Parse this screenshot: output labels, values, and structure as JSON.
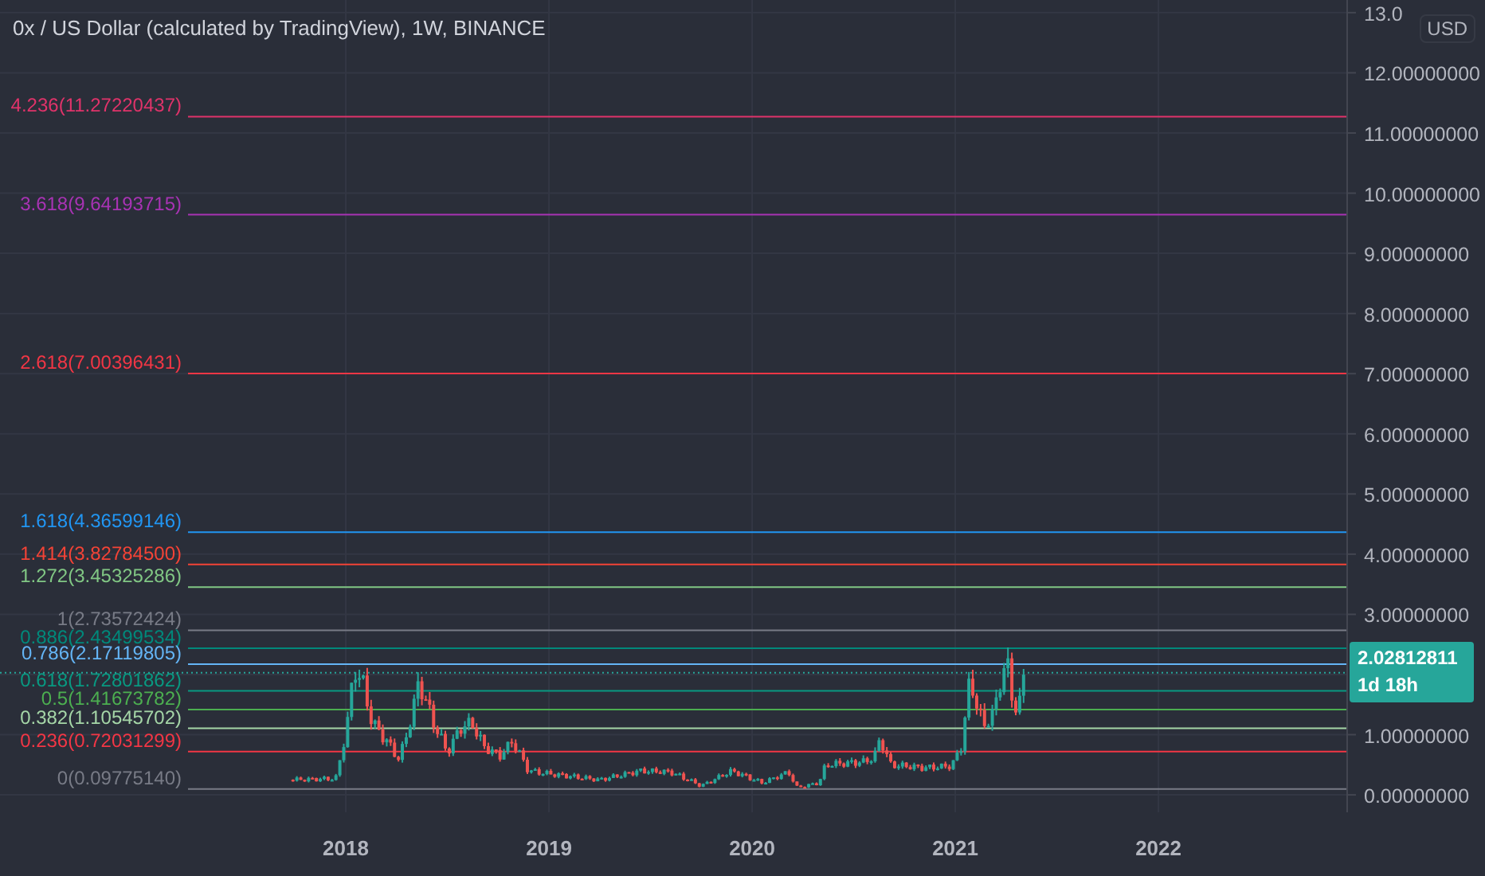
{
  "title": "0x / US Dollar (calculated by TradingView), 1W, BINANCE",
  "currency": "USD",
  "countdown": "1d 18h",
  "chart_data": {
    "type": "line",
    "grid": true,
    "xlim": [
      2016.298,
      2022.925
    ],
    "ylim": [
      -0.29,
      13.21
    ],
    "xticks": [
      {
        "value": 2018,
        "label": "2018"
      },
      {
        "value": 2019,
        "label": "2019"
      },
      {
        "value": 2020,
        "label": "2020"
      },
      {
        "value": 2021,
        "label": "2021"
      },
      {
        "value": 2022,
        "label": "2022"
      }
    ],
    "yticks": [
      {
        "value": 0,
        "label": "0.00000000"
      },
      {
        "value": 1,
        "label": "1.00000000"
      },
      {
        "value": 3,
        "label": "3.00000000"
      },
      {
        "value": 4,
        "label": "4.00000000"
      },
      {
        "value": 5,
        "label": "5.00000000"
      },
      {
        "value": 6,
        "label": "6.00000000"
      },
      {
        "value": 7,
        "label": "7.00000000"
      },
      {
        "value": 8,
        "label": "8.00000000"
      },
      {
        "value": 9,
        "label": "9.00000000"
      },
      {
        "value": 10,
        "label": "10.00000000"
      },
      {
        "value": 11,
        "label": "11.00000000"
      },
      {
        "value": 12,
        "label": "12.00000000"
      },
      {
        "value": 13,
        "label": "13.0"
      }
    ],
    "ref_lines": [
      {
        "axis": "y",
        "value": 11.27220437,
        "label": "4.236(11.27220437)",
        "color": "#e0336a"
      },
      {
        "axis": "y",
        "value": 9.64193715,
        "label": "3.618(9.64193715)",
        "color": "#a833b4"
      },
      {
        "axis": "y",
        "value": 7.00396431,
        "label": "2.618(7.00396431)",
        "color": "#f23645"
      },
      {
        "axis": "y",
        "value": 4.36599146,
        "label": "1.618(4.36599146)",
        "color": "#2196f3"
      },
      {
        "axis": "y",
        "value": 3.827845,
        "label": "1.414(3.82784500)",
        "color": "#f44336"
      },
      {
        "axis": "y",
        "value": 3.45325286,
        "label": "1.272(3.45325286)",
        "color": "#81c784"
      },
      {
        "axis": "y",
        "value": 2.73572424,
        "label": "1(2.73572424)",
        "color": "#787b86"
      },
      {
        "axis": "y",
        "value": 2.43499534,
        "label": "0.886(2.43499534)",
        "color": "#00897b"
      },
      {
        "axis": "y",
        "value": 2.17119805,
        "label": "0.786(2.17119805)",
        "color": "#64b5f6"
      },
      {
        "axis": "y",
        "value": 1.72801862,
        "label": "0.618(1.72801862)",
        "color": "#089981"
      },
      {
        "axis": "y",
        "value": 1.41673782,
        "label": "0.5(1.41673782)",
        "color": "#4caf50"
      },
      {
        "axis": "y",
        "value": 1.10545702,
        "label": "0.382(1.10545702)",
        "color": "#a5d6a7"
      },
      {
        "axis": "y",
        "value": 0.72031299,
        "label": "0.236(0.72031299)",
        "color": "#f23645"
      },
      {
        "axis": "y",
        "value": 0.0977514,
        "label": "0(0.09775140)",
        "color": "#787b86"
      },
      {
        "axis": "y",
        "value": 2.02812811,
        "label": "2.02812811",
        "color": "#26a69a"
      }
    ]
  }
}
